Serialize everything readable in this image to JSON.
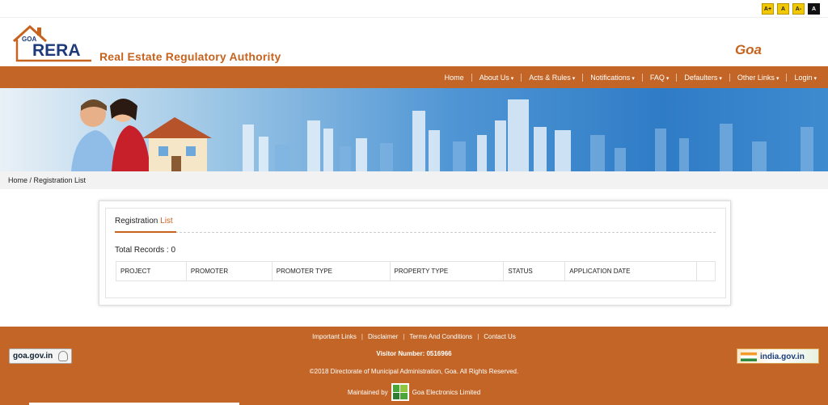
{
  "font_controls": [
    "A+",
    "A",
    "A-",
    "A"
  ],
  "header": {
    "logo_small": "GOA",
    "logo_big": "RERA",
    "tagline": "Real Estate Regulatory Authority",
    "state": "Goa"
  },
  "nav": {
    "items": [
      "Home",
      "About Us",
      "Acts & Rules",
      "Notifications",
      "FAQ",
      "Defaulters",
      "Other Links",
      "Login"
    ]
  },
  "breadcrumb": "Home / Registration List",
  "registration": {
    "title_part1": "Registration ",
    "title_part2": "List",
    "total_records": "Total Records : 0",
    "columns": [
      "PROJECT",
      "PROMOTER",
      "PROMOTER TYPE",
      "PROPERTY TYPE",
      "STATUS",
      "APPLICATION DATE",
      ""
    ]
  },
  "footer": {
    "links": [
      "Important Links",
      "Disclaimer",
      "Terms And Conditions",
      "Contact Us"
    ],
    "visitor": "Visitor Number: 0516966",
    "copyright": "©2018 Directorate of Municipal Administration, Goa. All Rights Reserved.",
    "maintained_by": "Maintained by",
    "maintainer": "Goa Electronics Limited",
    "left_badge": "goa.gov.in",
    "right_badge": "india.gov.in"
  },
  "colors": {
    "brand_orange": "#c26526",
    "accent_text": "#c6631f",
    "banner_blue": "#2f7cc6"
  }
}
